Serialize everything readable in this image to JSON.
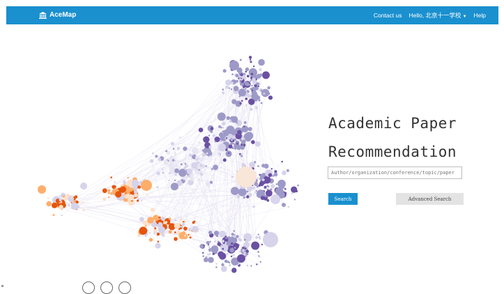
{
  "navbar": {
    "brand": "AceMap",
    "links": [
      "Contact us",
      "Hello, 北京十一学校",
      "Help"
    ],
    "bg_color": "#1a90cf"
  },
  "hero": {
    "title_line1": "Academic Paper",
    "title_line2": "Recommendation",
    "search_placeholder": "Author/organization/conference/topic/paper",
    "search_button": "Search",
    "advanced_button": "Advanced Search"
  },
  "graph_colors": {
    "purple_dark": "#6a51a3",
    "purple_mid": "#9e9ac8",
    "purple_light": "#d6d3ea",
    "orange_dark": "#e6550d",
    "orange_mid": "#fdae6b",
    "orange_light": "#fde0c8"
  },
  "carousel": {
    "dot_count": 3
  }
}
